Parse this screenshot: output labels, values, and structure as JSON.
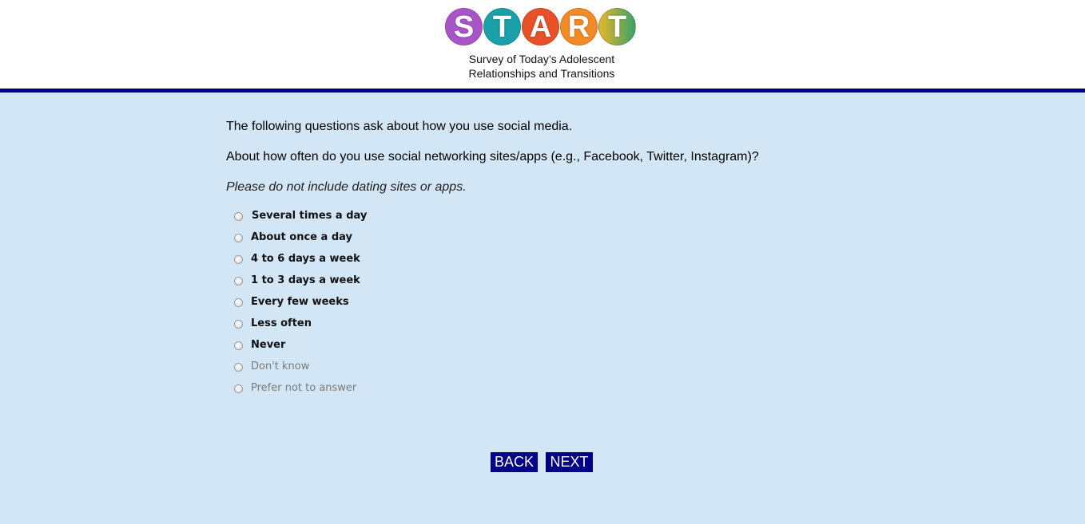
{
  "header": {
    "logo_letters": [
      "S",
      "T",
      "A",
      "R",
      "T"
    ],
    "logo_colors": [
      "#9b4fc8",
      "#1a9fa6",
      "#e8562a",
      "#f08a24",
      "#3aa36a"
    ],
    "tagline_line1": "Survey of Today’s Adolescent",
    "tagline_line2": "Relationships and Transitions",
    "rule_color": "#00008b"
  },
  "main": {
    "intro": "The following questions ask about how you use social media.",
    "question": "About how often do you use social networking sites/apps (e.g., Facebook, Twitter, Instagram)?",
    "instruction": "Please do not include dating sites or apps.",
    "options": [
      {
        "label": "Several times a day"
      },
      {
        "label": "About once a day"
      },
      {
        "label": "4 to 6 days a week"
      },
      {
        "label": "1 to 3 days a week"
      },
      {
        "label": "Every few weeks"
      },
      {
        "label": "Less often"
      },
      {
        "label": "Never"
      },
      {
        "label": "Don't know"
      },
      {
        "label": "Prefer not to answer"
      }
    ]
  },
  "nav": {
    "back_label": "BACK",
    "next_label": "NEXT"
  },
  "colors": {
    "page_background": "#d2e6f6",
    "button_background": "#00008b"
  }
}
